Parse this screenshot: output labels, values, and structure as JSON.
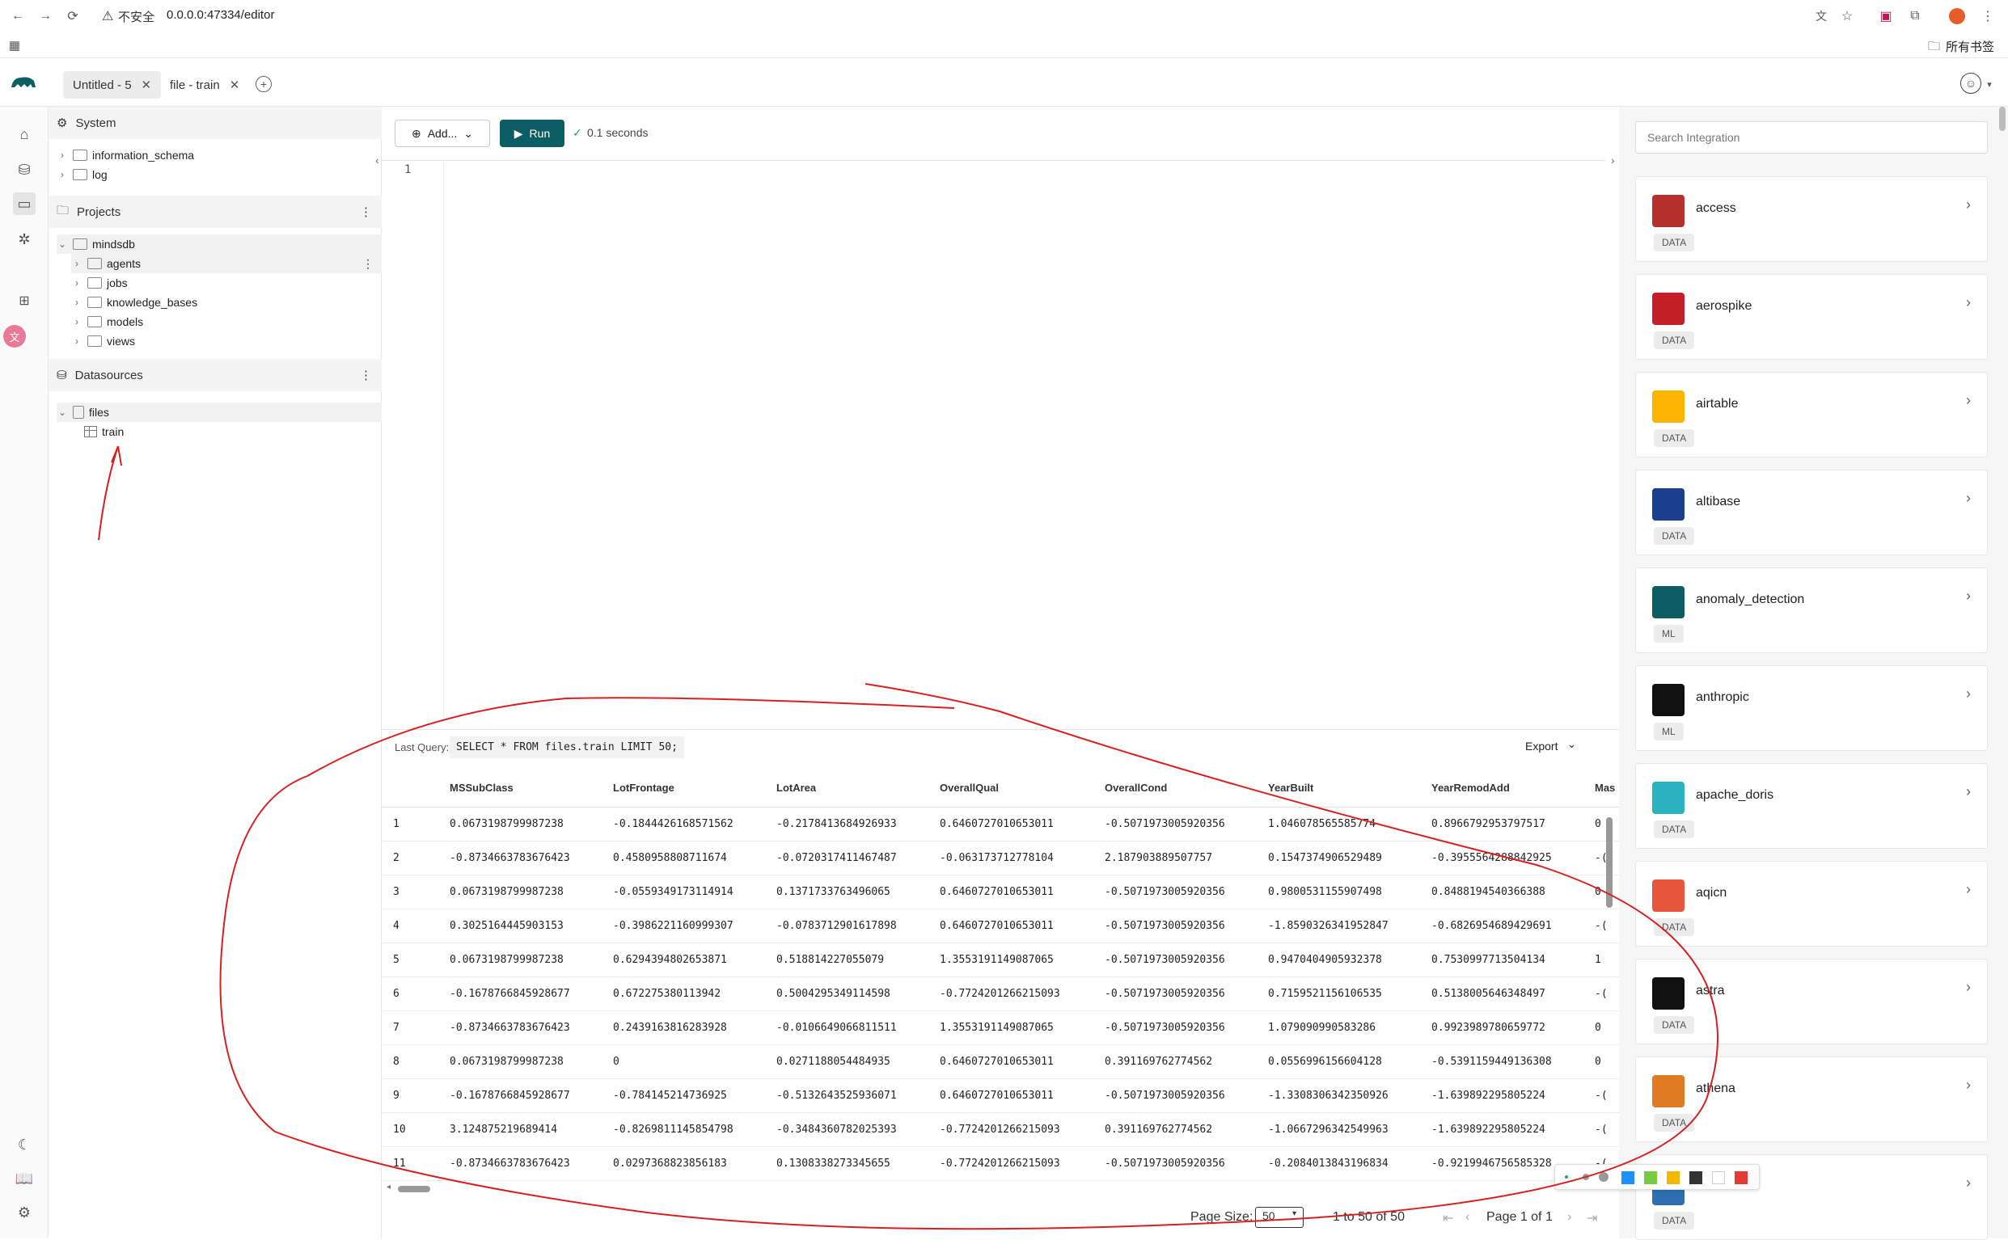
{
  "browser": {
    "security_label": "不安全",
    "url": "0.0.0.0:47334/editor",
    "bookmarks_label": "所有书签"
  },
  "tabs": [
    {
      "label": "Untitled - 5"
    },
    {
      "label": "file - train"
    }
  ],
  "sidebar": {
    "system_label": "System",
    "system_items": [
      "information_schema",
      "log"
    ],
    "projects_label": "Projects",
    "project_root": "mindsdb",
    "project_items": [
      "agents",
      "jobs",
      "knowledge_bases",
      "models",
      "views"
    ],
    "datasources_label": "Datasources",
    "datasource_root": "files",
    "datasource_items": [
      "train"
    ]
  },
  "editor": {
    "add_label": "Add...",
    "run_label": "Run",
    "status": "0.1 seconds",
    "line_number": "1"
  },
  "results": {
    "last_query_label": "Last Query:",
    "last_query": "SELECT * FROM files.train LIMIT 50;",
    "export_label": "Export",
    "columns": [
      "MSSubClass",
      "LotFrontage",
      "LotArea",
      "OverallQual",
      "OverallCond",
      "YearBuilt",
      "YearRemodAdd",
      "Mas"
    ],
    "rows": [
      [
        "1",
        "0.0673198799987238",
        "-0.1844426168571562",
        "-0.2178413684926933",
        "0.6460727010653011",
        "-0.5071973005920356",
        "1.046078565585774",
        "0.8966792953797517",
        "0"
      ],
      [
        "2",
        "-0.8734663783676423",
        "0.4580958808711674",
        "-0.0720317411467487",
        "-0.063173712778104",
        "2.187903889507757",
        "0.1547374906529489",
        "-0.3955564288842925",
        "-("
      ],
      [
        "3",
        "0.0673198799987238",
        "-0.0559349173114914",
        "0.1371733763496065",
        "0.6460727010653011",
        "-0.5071973005920356",
        "0.9800531155907498",
        "0.8488194540366388",
        "0"
      ],
      [
        "4",
        "0.3025164445903153",
        "-0.3986221160999307",
        "-0.0783712901617898",
        "0.6460727010653011",
        "-0.5071973005920356",
        "-1.8590326341952847",
        "-0.6826954689429691",
        "-("
      ],
      [
        "5",
        "0.0673198799987238",
        "0.6294394802653871",
        "0.518814227055079",
        "1.3553191149087065",
        "-0.5071973005920356",
        "0.9470404905932378",
        "0.7530997713504134",
        "1"
      ],
      [
        "6",
        "-0.1678766845928677",
        "0.672275380113942",
        "0.5004295349114598",
        "-0.7724201266215093",
        "-0.5071973005920356",
        "0.7159521156106535",
        "0.5138005646348497",
        "-("
      ],
      [
        "7",
        "-0.8734663783676423",
        "0.2439163816283928",
        "-0.0106649066811511",
        "1.3553191149087065",
        "-0.5071973005920356",
        "1.079090990583286",
        "0.9923989780659772",
        "0"
      ],
      [
        "8",
        "0.0673198799987238",
        "0",
        "0.0271188054484935",
        "0.6460727010653011",
        "0.391169762774562",
        "0.0556996156604128",
        "-0.5391159449136308",
        "0"
      ],
      [
        "9",
        "-0.1678766845928677",
        "-0.784145214736925",
        "-0.5132643525936071",
        "0.6460727010653011",
        "-0.5071973005920356",
        "-1.3308306342350926",
        "-1.639892295805224",
        "-("
      ],
      [
        "10",
        "3.124875219689414",
        "-0.8269811145854798",
        "-0.3484360782025393",
        "-0.7724201266215093",
        "0.391169762774562",
        "-1.0667296342549963",
        "-1.639892295805224",
        "-("
      ],
      [
        "11",
        "-0.8734663783676423",
        "0.0297368823856183",
        "0.1308338273345655",
        "-0.7724201266215093",
        "-0.5071973005920356",
        "-0.2084013843196834",
        "-0.9219946756585328",
        "-("
      ]
    ],
    "page_size_label": "Page Size:",
    "page_size_value": "50",
    "range_text": "1 to 50 of 50",
    "page_text": "Page 1 of 1"
  },
  "integrations": {
    "search_placeholder": "Search Integration",
    "items": [
      {
        "name": "access",
        "badge": "DATA",
        "color": "#b7312c",
        "icon": "access-icon"
      },
      {
        "name": "aerospike",
        "badge": "DATA",
        "color": "#c22026",
        "icon": "aerospike-icon"
      },
      {
        "name": "airtable",
        "badge": "DATA",
        "color": "#fcb400",
        "icon": "airtable-icon"
      },
      {
        "name": "altibase",
        "badge": "DATA",
        "color": "#1a3f8f",
        "icon": "altibase-icon"
      },
      {
        "name": "anomaly_detection",
        "badge": "ML",
        "color": "#0d5e64",
        "icon": "anomaly-detection-icon"
      },
      {
        "name": "anthropic",
        "badge": "ML",
        "color": "#111111",
        "icon": "anthropic-icon"
      },
      {
        "name": "apache_doris",
        "badge": "DATA",
        "color": "#2bb3c0",
        "icon": "apache-doris-icon"
      },
      {
        "name": "aqicn",
        "badge": "DATA",
        "color": "#e9543f",
        "icon": "aqicn-icon"
      },
      {
        "name": "astra",
        "badge": "DATA",
        "color": "#111111",
        "icon": "astra-icon"
      },
      {
        "name": "athena",
        "badge": "DATA",
        "color": "#e07b22",
        "icon": "athena-icon"
      },
      {
        "name": "",
        "badge": "DATA",
        "color": "#2f6fb0",
        "icon": "integration-icon"
      }
    ]
  }
}
